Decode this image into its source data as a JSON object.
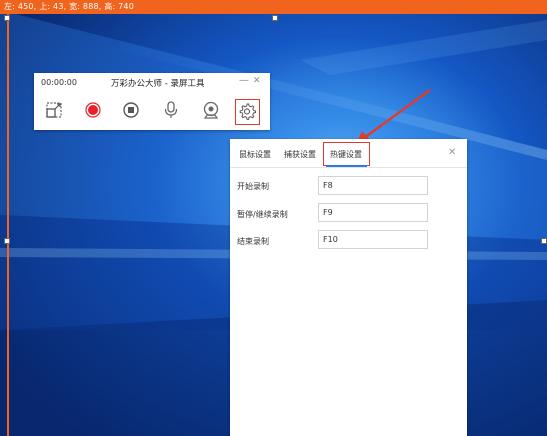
{
  "selection": {
    "info": "左: 450, 上: 43, 宽: 888, 高: 740"
  },
  "recorder": {
    "time": "00:00:00",
    "title": "万彩办公大师 - 录屏工具",
    "minimize_icon": "minimize-icon",
    "close_icon": "close-icon",
    "tools": [
      "region-select-icon",
      "record-icon",
      "stop-icon",
      "microphone-icon",
      "webcam-icon",
      "gear-icon"
    ]
  },
  "settings": {
    "tabs": [
      {
        "label": "鼠标设置"
      },
      {
        "label": "捕获设置"
      },
      {
        "label": "热键设置"
      }
    ],
    "active_tab": "热键设置",
    "rows": [
      {
        "label": "开始录制",
        "value": "F8"
      },
      {
        "label": "暂停/继续录制",
        "value": "F9"
      },
      {
        "label": "结束录制",
        "value": "F10"
      }
    ]
  },
  "colors": {
    "accent": "#f0641e",
    "highlight": "#e03b2c",
    "record_red": "#e8202a",
    "tab_active": "#2a7be4"
  }
}
